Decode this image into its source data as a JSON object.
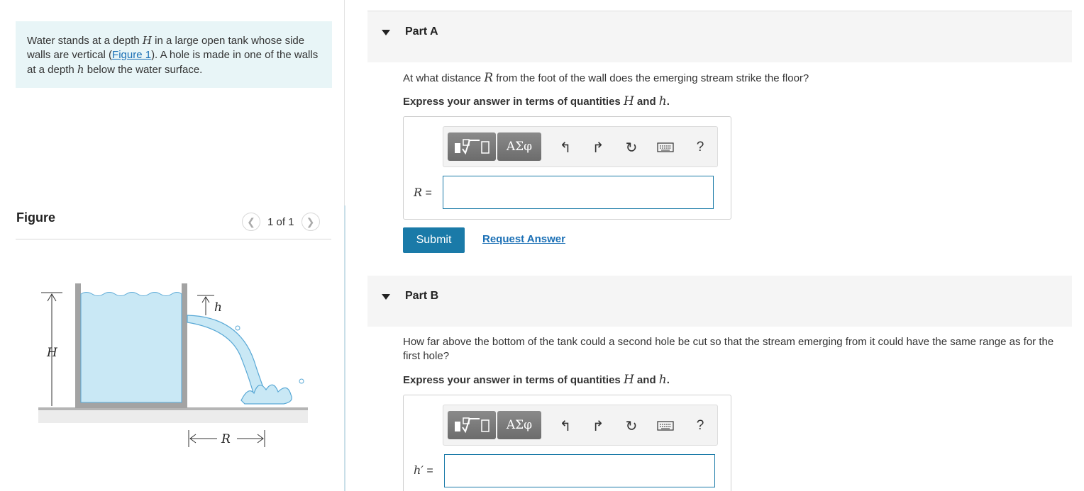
{
  "intro": {
    "text_1": "Water stands at a depth ",
    "var_H": "H",
    "text_2": " in a large open tank whose side walls are vertical (",
    "figure_link": "Figure 1",
    "text_3": "). A hole is made in one of the walls at a depth ",
    "var_h": "h",
    "text_4": " below the water surface."
  },
  "figure": {
    "title": "Figure",
    "pager": "1 of 1",
    "label_H": "H",
    "label_h": "h",
    "label_R": "R",
    "water_color": "#c9e8f5",
    "wall_color": "#a3a3a3"
  },
  "part_a": {
    "title": "Part A",
    "question_1": "At what distance ",
    "question_var": "R",
    "question_2": " from the foot of the wall does the emerging stream strike the floor?",
    "instr_1": "Express your answer in terms of quantities ",
    "instr_var1": "H",
    "instr_and": " and ",
    "instr_var2": "h",
    "instr_end": ".",
    "eq_var": "R",
    "eq_sign": " =",
    "input_value": "",
    "submit": "Submit",
    "request": "Request Answer"
  },
  "part_b": {
    "title": "Part B",
    "question": "How far above the bottom of the tank could a second hole be cut so that the stream emerging from it could have the same range as for the first hole?",
    "instr_1": "Express your answer in terms of quantities ",
    "instr_var1": "H",
    "instr_and": " and ",
    "instr_var2": "h",
    "instr_end": ".",
    "eq_var": "h′",
    "eq_sign": " =",
    "input_value": ""
  },
  "toolbar": {
    "greek": "ΑΣφ",
    "help": "?",
    "icons": [
      "templates-icon",
      "greek-symbols-icon",
      "undo-icon",
      "redo-icon",
      "reset-icon",
      "keyboard-icon",
      "help-icon"
    ]
  },
  "colors": {
    "accent": "#1a7aa8",
    "intro_bg": "#e8f5f7",
    "link": "#1a6fb5"
  }
}
